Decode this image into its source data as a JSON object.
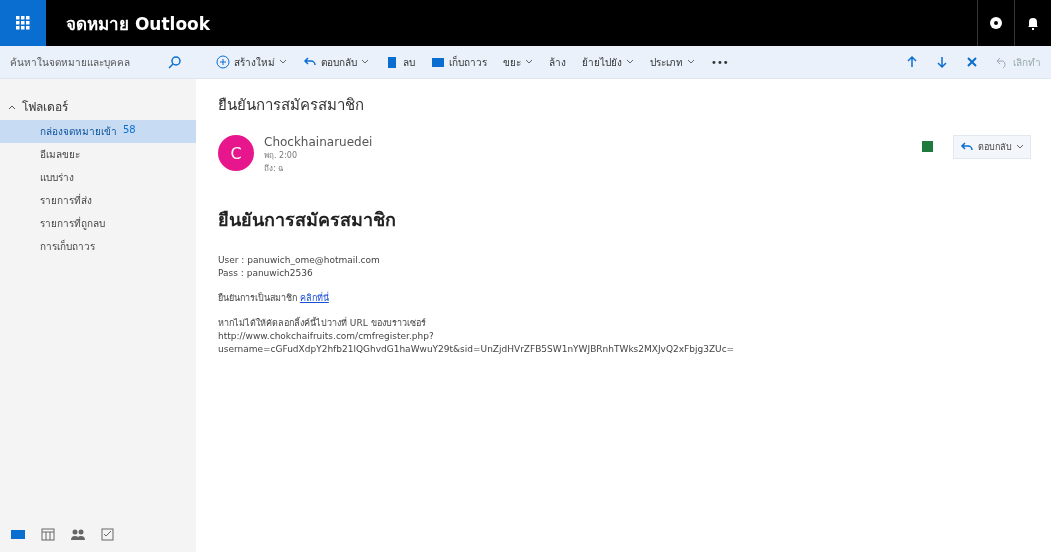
{
  "header": {
    "app_title": "จดหมาย Outlook"
  },
  "search": {
    "placeholder": "ค้นหาในจดหมายและบุคคล"
  },
  "toolbar": [
    {
      "kind": "new",
      "label": "สร้างใหม่",
      "dropdown": true
    },
    {
      "kind": "reply",
      "label": "ตอบกลับ",
      "dropdown": true
    },
    {
      "kind": "delete",
      "label": "ลบ",
      "dropdown": false
    },
    {
      "kind": "archive",
      "label": "เก็บถาวร",
      "dropdown": false
    },
    {
      "kind": "text",
      "label": "ขยะ",
      "dropdown": true
    },
    {
      "kind": "text",
      "label": "ล้าง",
      "dropdown": false
    },
    {
      "kind": "text",
      "label": "ย้ายไปยัง",
      "dropdown": true
    },
    {
      "kind": "text",
      "label": "ประเภท",
      "dropdown": true
    },
    {
      "kind": "text",
      "label": "•••",
      "dropdown": false
    }
  ],
  "toolbar_right": [
    {
      "kind": "up"
    },
    {
      "kind": "down"
    },
    {
      "kind": "close"
    },
    {
      "kind": "undo",
      "label": "เลิกทำ",
      "disabled": true
    }
  ],
  "sidebar": {
    "heading": "โฟลเดอร์",
    "expanded": true,
    "items": [
      {
        "label": "กล่องจดหมายเข้า",
        "count": "58",
        "selected": true
      },
      {
        "label": "อีเมลขยะ",
        "selected": false
      },
      {
        "label": "แบบร่าง",
        "selected": false
      },
      {
        "label": "รายการที่ส่ง",
        "selected": false
      },
      {
        "label": "รายการที่ถูกลบ",
        "selected": false
      },
      {
        "label": "การเก็บถาวร",
        "selected": false
      }
    ]
  },
  "bottom_nav": [
    {
      "kind": "mail",
      "selected": true
    },
    {
      "kind": "calendar",
      "selected": false
    },
    {
      "kind": "people",
      "selected": false
    },
    {
      "kind": "tasks",
      "selected": false
    }
  ],
  "message": {
    "subject": "ยืนยันการสมัครสมาชิก",
    "sender": "Chockhainaruedei",
    "avatar_letter": "C",
    "date": "พฤ. 2:00",
    "to": "ถึง: ฉ",
    "reply_label": "ตอบกลับ",
    "body": {
      "heading": "ยืนยันการสมัครสมาชิก",
      "credentials": [
        "User : panuwich_ome@hotmail.com",
        "Pass : panuwich2536"
      ],
      "confirm_text": "ยืนยันการเป็นสมาชิก",
      "confirm_link": "คลิกที่นี่",
      "fallback_text": "หากไม่ได้ให้คัดลอกลิ้งค์นี้ไปวางที่ URL ของบราวเซอร์",
      "url_lines": [
        "http://www.chokchaifruits.com/cmfregister.php?",
        "username=cGFudXdpY2hfb21lQGhvdG1haWwuY29t&sid=UnZjdHVrZFB5SW1nYWJBRnhTWks2MXJvQ2xFbjg3ZUc="
      ]
    }
  }
}
